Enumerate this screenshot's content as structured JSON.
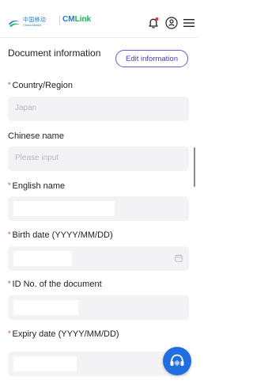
{
  "header": {
    "logo_cn": "中国移动",
    "logo_en": "China Mobile",
    "logo_cmlink_cm": "CM",
    "logo_cmlink_link": "Link"
  },
  "section": {
    "title": "Document information",
    "edit_label": "Edit information"
  },
  "form": {
    "country": {
      "label": "Country/Region",
      "value": "Japan",
      "required": true
    },
    "chinese_name": {
      "label": "Chinese name",
      "placeholder": "Please input",
      "required": false
    },
    "english_name": {
      "label": "English name",
      "required": true
    },
    "birth_date": {
      "label": "Birth date (YYYY/MM/DD)",
      "required": true
    },
    "id_no": {
      "label": "ID No. of the document",
      "required": true
    },
    "expiry_date": {
      "label": "Expiry date (YYYY/MM/DD)",
      "required": true
    }
  },
  "icons": {
    "bell": "bell-icon",
    "user": "user-icon",
    "menu": "menu-icon",
    "calendar": "calendar-icon",
    "support": "headset-icon"
  },
  "colors": {
    "brand_blue": "#1a7bd6",
    "brand_green": "#19b24b",
    "accent_purple": "#6a5bd6",
    "required_red": "#e53935",
    "notification_red": "#e53935",
    "support_blue": "#1f6fe0"
  }
}
